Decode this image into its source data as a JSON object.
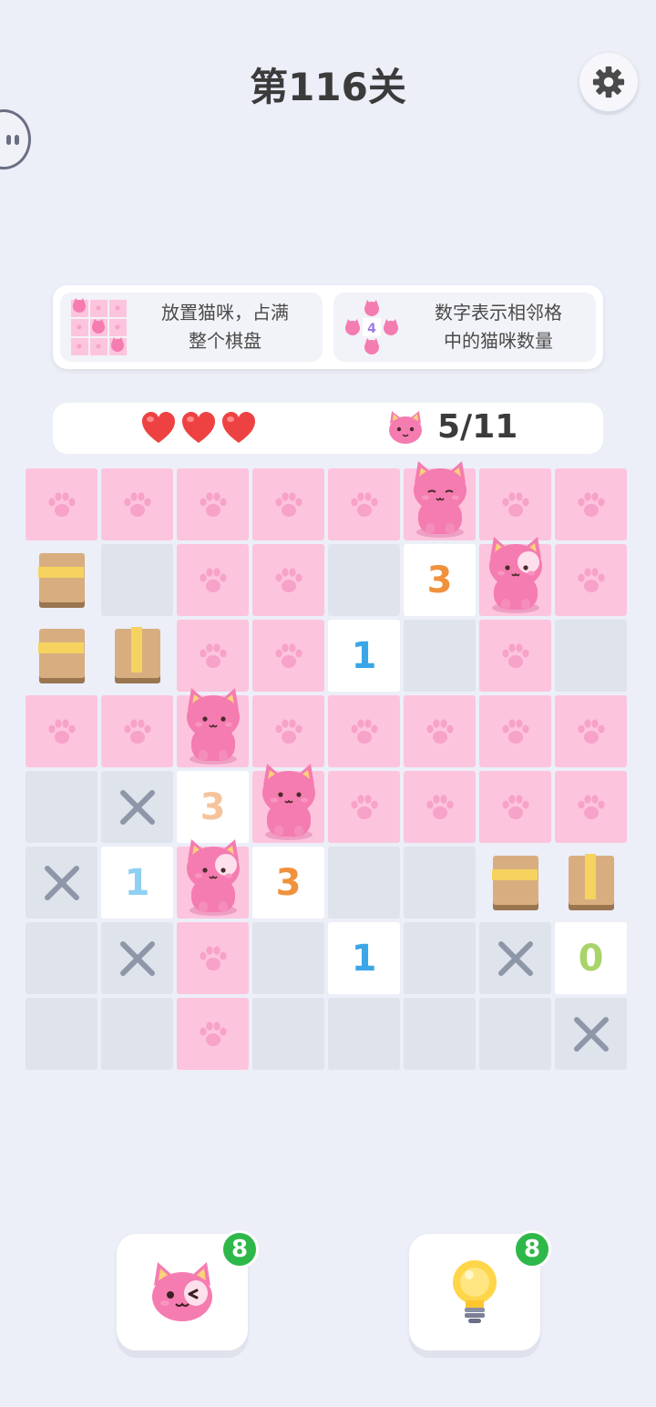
{
  "header": {
    "level_title": "第116关",
    "settings_icon": "gear-icon"
  },
  "rules": [
    {
      "text": "放置猫咪，占满\n整个棋盘",
      "icon": "cat-grid-icon"
    },
    {
      "text": "数字表示相邻格\n中的猫咪数量",
      "icon": "cat-neighbors-icon",
      "icon_number": "4"
    }
  ],
  "status": {
    "lives": 3,
    "cats_label": "5/11"
  },
  "colors": {
    "paw_tile": "#fdc4dd",
    "empty_tile": "#dfe3ec",
    "number_tile": "#ffffff",
    "heart": "#ee4242",
    "badge": "#2fb84a"
  },
  "board": {
    "rows": [
      [
        {
          "t": "paw"
        },
        {
          "t": "paw"
        },
        {
          "t": "paw"
        },
        {
          "t": "paw"
        },
        {
          "t": "paw"
        },
        {
          "t": "cat",
          "v": "sleep"
        },
        {
          "t": "paw"
        },
        {
          "t": "paw"
        }
      ],
      [
        {
          "t": "box",
          "v": "h"
        },
        {
          "t": "empty"
        },
        {
          "t": "paw"
        },
        {
          "t": "paw"
        },
        {
          "t": "empty"
        },
        {
          "t": "num",
          "n": "3",
          "c": "#f0913c"
        },
        {
          "t": "cat",
          "v": "patch"
        },
        {
          "t": "paw"
        }
      ],
      [
        {
          "t": "box",
          "v": "h"
        },
        {
          "t": "box",
          "v": "v"
        },
        {
          "t": "paw"
        },
        {
          "t": "paw"
        },
        {
          "t": "num",
          "n": "1",
          "c": "#3aa6e8"
        },
        {
          "t": "empty"
        },
        {
          "t": "paw"
        },
        {
          "t": "empty"
        }
      ],
      [
        {
          "t": "paw"
        },
        {
          "t": "paw"
        },
        {
          "t": "cat",
          "v": "smile"
        },
        {
          "t": "paw"
        },
        {
          "t": "paw"
        },
        {
          "t": "paw"
        },
        {
          "t": "paw"
        },
        {
          "t": "paw"
        }
      ],
      [
        {
          "t": "empty"
        },
        {
          "t": "x"
        },
        {
          "t": "num",
          "n": "3",
          "c": "#f6c49c"
        },
        {
          "t": "cat",
          "v": "smile"
        },
        {
          "t": "paw"
        },
        {
          "t": "paw"
        },
        {
          "t": "paw"
        },
        {
          "t": "paw"
        }
      ],
      [
        {
          "t": "x"
        },
        {
          "t": "num",
          "n": "1",
          "c": "#8fd0f2"
        },
        {
          "t": "cat",
          "v": "patch"
        },
        {
          "t": "num",
          "n": "3",
          "c": "#f0913c"
        },
        {
          "t": "empty"
        },
        {
          "t": "empty"
        },
        {
          "t": "box",
          "v": "h"
        },
        {
          "t": "box",
          "v": "v"
        }
      ],
      [
        {
          "t": "empty"
        },
        {
          "t": "x"
        },
        {
          "t": "paw"
        },
        {
          "t": "empty"
        },
        {
          "t": "num",
          "n": "1",
          "c": "#3aa6e8"
        },
        {
          "t": "empty"
        },
        {
          "t": "x"
        },
        {
          "t": "num",
          "n": "0",
          "c": "#a8d46a"
        }
      ],
      [
        {
          "t": "empty"
        },
        {
          "t": "empty"
        },
        {
          "t": "paw"
        },
        {
          "t": "empty"
        },
        {
          "t": "empty"
        },
        {
          "t": "empty"
        },
        {
          "t": "empty"
        },
        {
          "t": "x"
        }
      ]
    ]
  },
  "tools": [
    {
      "icon": "wink-cat-icon",
      "count": "8"
    },
    {
      "icon": "lightbulb-icon",
      "count": "8"
    }
  ]
}
